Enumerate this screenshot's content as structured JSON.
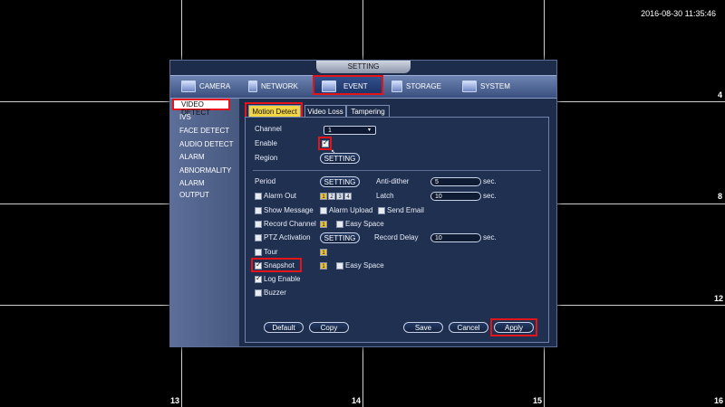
{
  "clock": "2016-08-30 11:35:46",
  "cell_numbers": [
    "4",
    "8",
    "12",
    "13",
    "14",
    "15",
    "16"
  ],
  "dialog": {
    "title": "SETTING",
    "main_tabs": [
      {
        "label": "CAMERA",
        "icon": "camera-icon"
      },
      {
        "label": "NETWORK",
        "icon": "network-icon"
      },
      {
        "label": "EVENT",
        "icon": "event-icon"
      },
      {
        "label": "STORAGE",
        "icon": "storage-icon"
      },
      {
        "label": "SYSTEM",
        "icon": "system-icon"
      }
    ],
    "sidebar": [
      "VIDEO DETECT",
      "IVS",
      "FACE DETECT",
      "AUDIO DETECT",
      "ALARM",
      "ABNORMALITY",
      "ALARM OUTPUT"
    ],
    "sub_tabs": [
      "Motion Detect",
      "Video Loss",
      "Tampering"
    ],
    "form": {
      "channel_label": "Channel",
      "channel_value": "1",
      "enable_label": "Enable",
      "region_label": "Region",
      "region_button": "SETTING",
      "period_label": "Period",
      "period_button": "SETTING",
      "anti_dither_label": "Anti-dither",
      "anti_dither_value": "5",
      "anti_dither_unit": "sec.",
      "alarm_out_label": "Alarm Out",
      "alarm_channels": [
        "1",
        "2",
        "3",
        "4"
      ],
      "latch_label": "Latch",
      "latch_value": "10",
      "latch_unit": "sec.",
      "show_message_label": "Show Message",
      "alarm_upload_label": "Alarm Upload",
      "send_email_label": "Send Email",
      "record_channel_label": "Record Channel",
      "record_channel_num": "1",
      "easy_space_label": "Easy Space",
      "ptz_label": "PTZ Activation",
      "ptz_button": "SETTING",
      "record_delay_label": "Record Delay",
      "record_delay_value": "10",
      "record_delay_unit": "sec.",
      "tour_label": "Tour",
      "tour_num": "1",
      "snapshot_label": "Snapshot",
      "snapshot_num": "1",
      "easy_space_label2": "Easy Space",
      "log_enable_label": "Log Enable",
      "buzzer_label": "Buzzer"
    },
    "buttons": {
      "default": "Default",
      "copy": "Copy",
      "save": "Save",
      "cancel": "Cancel",
      "apply": "Apply"
    }
  }
}
